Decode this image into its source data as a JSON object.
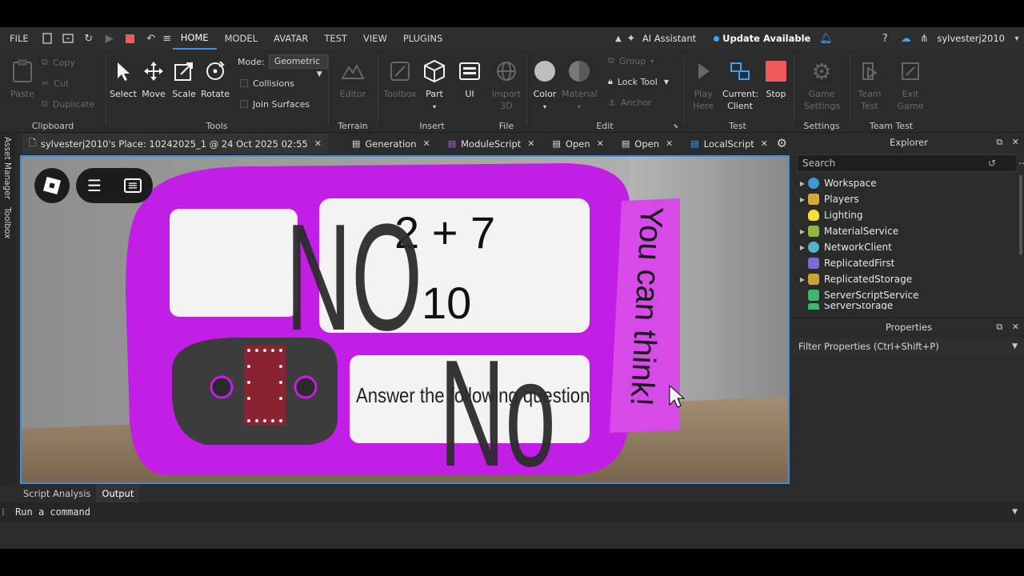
{
  "menubar": {
    "file": "FILE",
    "tabs": [
      "HOME",
      "MODEL",
      "AVATAR",
      "TEST",
      "VIEW",
      "PLUGINS"
    ],
    "ai_assistant": "AI Assistant",
    "update": "Update Available",
    "username": "sylvesterj2010"
  },
  "ribbon": {
    "clipboard": {
      "paste": "Paste",
      "copy": "Copy",
      "cut": "Cut",
      "duplicate": "Duplicate",
      "label": "Clipboard"
    },
    "tools": {
      "select": "Select",
      "move": "Move",
      "scale": "Scale",
      "rotate": "Rotate",
      "mode_label": "Mode:",
      "mode_value": "Geometric",
      "collisions": "Collisions",
      "join_surfaces": "Join Surfaces",
      "label": "Tools"
    },
    "terrain": {
      "editor": "Editor",
      "label": "Terrain"
    },
    "insert": {
      "toolbox": "Toolbox",
      "part": "Part",
      "ui": "UI",
      "label": "Insert"
    },
    "file": {
      "import3d_a": "Import",
      "import3d_b": "3D",
      "label": "File"
    },
    "edit": {
      "color": "Color",
      "material": "Material",
      "group": "Group",
      "lock_tool": "Lock Tool",
      "anchor": "Anchor",
      "label": "Edit"
    },
    "test": {
      "play_a": "Play",
      "play_b": "Here",
      "current_a": "Current:",
      "current_b": "Client",
      "stop": "Stop",
      "label": "Test"
    },
    "settings": {
      "game_a": "Game",
      "game_b": "Settings",
      "label": "Settings"
    },
    "teamtest": {
      "team_a": "Team",
      "team_b": "Test",
      "exit_a": "Exit",
      "exit_b": "Game",
      "label": "Team Test"
    }
  },
  "doc_tabs": [
    "sylvesterj2010's Place: 10242025_1 @ 24 Oct 2025 02:55",
    "Generation",
    "ModuleScript",
    "Open",
    "Open",
    "LocalScript"
  ],
  "left_strip": {
    "asset_manager": "Asset Manager",
    "toolbox": "Toolbox"
  },
  "scene": {
    "equation": "2 + 7",
    "answer": "10",
    "big_no_1": "NO",
    "big_no_2": "No",
    "instruction": "Answer the following question",
    "side_text": "You can think!"
  },
  "explorer": {
    "title": "Explorer",
    "search_placeholder": "Search",
    "items": [
      "Workspace",
      "Players",
      "Lighting",
      "MaterialService",
      "NetworkClient",
      "ReplicatedFirst",
      "ReplicatedStorage",
      "ServerScriptService",
      "ServerStorage"
    ]
  },
  "properties": {
    "title": "Properties",
    "filter": "Filter Properties (Ctrl+Shift+P)"
  },
  "bottom": {
    "tabs": [
      "Script Analysis",
      "Output"
    ],
    "command_placeholder": "Run a command"
  },
  "colors": {
    "accent": "#4a90e2",
    "viewport_border": "#3b8fe0",
    "stop_red": "#f05a5a",
    "magenta": "#c21fe6"
  }
}
